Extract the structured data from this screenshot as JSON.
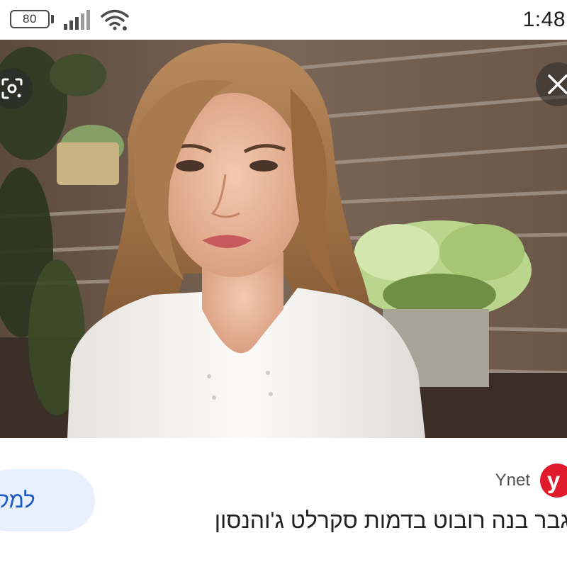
{
  "status_bar": {
    "battery_level": "80",
    "time": "1:48"
  },
  "image_viewer": {
    "lens_icon": "google-lens-icon",
    "close_icon": "close-icon",
    "image_subject": "Robot with long wavy brown hair wearing a white button-up top, green plants and wooden slatted wall in background"
  },
  "result_card": {
    "source_logo_letter": "y",
    "source_name": "Ynet",
    "headline": "גבר בנה רובוט בדמות סקרלט ג'והנסון",
    "visit_label": "למקור",
    "accent_color": "#e01a2b",
    "button_bg_color": "#e8f0fe",
    "button_text_color": "#1a5bc4"
  }
}
